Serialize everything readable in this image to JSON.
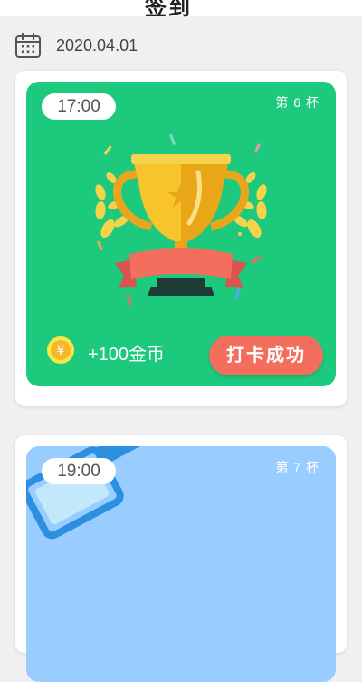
{
  "header": {
    "title": "签到"
  },
  "date_row": {
    "icon": "calendar-icon",
    "date": "2020.04.01"
  },
  "cards": [
    {
      "time": "17:00",
      "cup_label": "第 6 杯",
      "art_icon": "trophy-icon",
      "reward_icon": "coin-icon",
      "reward_text": "+100金币",
      "status_button": "打卡成功",
      "panel_color": "#1dc97c",
      "button_color": "#f36e5c"
    },
    {
      "time": "19:00",
      "cup_label": "第 7 杯",
      "art_icon": "water-glass-icon",
      "panel_color": "#99ccff"
    }
  ]
}
